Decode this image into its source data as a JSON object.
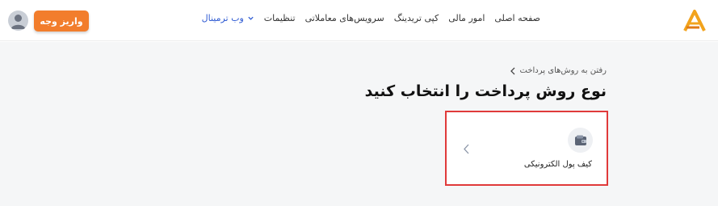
{
  "header": {
    "logo": "brand-logo",
    "nav": [
      {
        "label": "صفحه اصلی"
      },
      {
        "label": "امور مالی"
      },
      {
        "label": "کپی تریدینگ"
      },
      {
        "label": "سرویس‌های معاملاتی"
      },
      {
        "label": "تنظیمات"
      },
      {
        "label": "وب ترمینال"
      }
    ],
    "deposit_button": "واریز وجه",
    "avatar": "user-avatar-icon"
  },
  "main": {
    "back_link": "رفتن به روش‌های پرداخت",
    "title": "نوع روش پرداخت را انتخاب کنید",
    "methods": [
      {
        "label": "کیف پول الکترونیکی",
        "icon": "wallet-icon"
      }
    ]
  },
  "colors": {
    "accent": "#f27d2c",
    "highlight_border": "#e03a3a",
    "link_blue": "#2f5bd3",
    "background": "#f5f6f7"
  }
}
